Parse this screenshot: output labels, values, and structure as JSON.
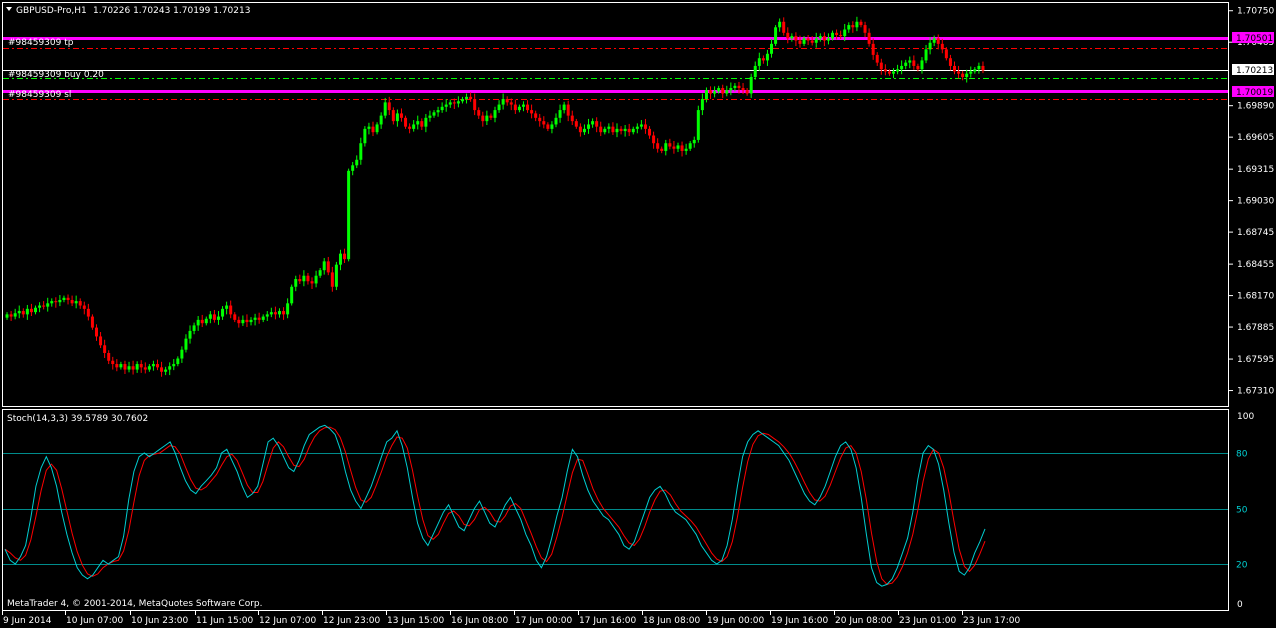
{
  "window": {
    "symbol_title": "GBPUSD-Pro,H1",
    "ohlc_readout": "1.70226 1.70243 1.70199 1.70213"
  },
  "orders": [
    {
      "label": "#98459309 tp",
      "type": "tp",
      "price": 1.70501,
      "price_label": "1.70501",
      "color": "#FF00FF"
    },
    {
      "label": "#98459309 buy 0.20",
      "type": "entry",
      "price": 1.70213,
      "color": "#00FF00"
    },
    {
      "label": "#98459309 sl",
      "type": "sl",
      "price": 1.70019,
      "price_label": "1.70019",
      "color": "#FF00FF"
    }
  ],
  "current_price": {
    "value": 1.70213,
    "label": "1.70213"
  },
  "price_axis": {
    "ticks": [
      "1.70750",
      "1.70465",
      "1.69890",
      "1.69605",
      "1.69315",
      "1.69030",
      "1.68745",
      "1.68455",
      "1.68170",
      "1.67885",
      "1.67595",
      "1.67310"
    ]
  },
  "indicator": {
    "label": "Stoch(14,3,3) 39.5789 30.7602",
    "main_value": 39.5789,
    "signal_value": 30.7602,
    "levels": [
      80,
      50,
      20
    ],
    "level_labels": [
      "80",
      "50",
      "20"
    ],
    "axis_ticks": [
      "100",
      "0"
    ],
    "main_color": "#00CED1",
    "signal_color": "#FF0000"
  },
  "footer": {
    "copyright": "MetaTrader 4, © 2001-2014, MetaQuotes Software Corp."
  },
  "time_axis": {
    "labels": [
      "9 Jun 2014",
      "10 Jun 07:00",
      "10 Jun 23:00",
      "11 Jun 15:00",
      "12 Jun 07:00",
      "12 Jun 23:00",
      "13 Jun 15:00",
      "16 Jun 08:00",
      "17 Jun 00:00",
      "17 Jun 16:00",
      "18 Jun 08:00",
      "19 Jun 00:00",
      "19 Jun 16:00",
      "20 Jun 08:00",
      "23 Jun 01:00",
      "23 Jun 17:00"
    ]
  },
  "colors": {
    "background": "#000000",
    "bull_candle": "#00FF00",
    "bear_candle": "#FF0000",
    "grid_line": "#FFFFFF",
    "order_line": "#FF0000"
  },
  "chart_data": {
    "type": "candlestick",
    "title": "GBPUSD-Pro,H1",
    "series": [
      {
        "name": "GBPUSD",
        "close": [
          1.68,
          1.6798,
          1.6801,
          1.6803,
          1.68,
          1.6805,
          1.6802,
          1.6806,
          1.6808,
          1.6807,
          1.681,
          1.6812,
          1.6811,
          1.6813,
          1.6815,
          1.6813,
          1.681,
          1.6812,
          1.6808,
          1.6805,
          1.6798,
          1.6788,
          1.678,
          1.6772,
          1.6765,
          1.6758,
          1.6755,
          1.6752,
          1.6755,
          1.675,
          1.6753,
          1.675,
          1.6755,
          1.6752,
          1.675,
          1.6753,
          1.6755,
          1.6752,
          1.6748,
          1.675,
          1.6753,
          1.6755,
          1.676,
          1.6768,
          1.6778,
          1.6785,
          1.679,
          1.6795,
          1.6792,
          1.6796,
          1.68,
          1.6795,
          1.6798,
          1.6805,
          1.6808,
          1.68,
          1.6795,
          1.6792,
          1.6795,
          1.6793,
          1.6795,
          1.6797,
          1.6795,
          1.6798,
          1.68,
          1.6802,
          1.68,
          1.6803,
          1.68,
          1.681,
          1.6825,
          1.6832,
          1.683,
          1.6835,
          1.683,
          1.6828,
          1.6835,
          1.684,
          1.6848,
          1.6838,
          1.6825,
          1.6845,
          1.6855,
          1.685,
          1.693,
          1.6935,
          1.694,
          1.6955,
          1.6968,
          1.697,
          1.6965,
          1.6972,
          1.698,
          1.6992,
          1.6985,
          1.6975,
          1.6982,
          1.6978,
          1.697,
          1.6968,
          1.6972,
          1.6975,
          1.697,
          1.6978,
          1.698,
          1.6983,
          1.6985,
          1.6988,
          1.699,
          1.6992,
          1.6991,
          1.6993,
          1.6995,
          1.6997,
          1.6995,
          1.6985,
          1.698,
          1.6975,
          1.698,
          1.6978,
          1.6985,
          1.699,
          1.6995,
          1.6992,
          1.699,
          1.6985,
          1.6988,
          1.699,
          1.6985,
          1.6982,
          1.6978,
          1.6975,
          1.6972,
          1.6968,
          1.6972,
          1.6978,
          1.6985,
          1.699,
          1.698,
          1.6975,
          1.697,
          1.6965,
          1.6968,
          1.6972,
          1.6975,
          1.697,
          1.6965,
          1.6968,
          1.697,
          1.6965,
          1.6968,
          1.6966,
          1.6968,
          1.6965,
          1.6968,
          1.697,
          1.6972,
          1.6968,
          1.6962,
          1.6955,
          1.695,
          1.6948,
          1.6955,
          1.6952,
          1.695,
          1.6953,
          1.6948,
          1.695,
          1.6955,
          1.6958,
          1.6985,
          1.6995,
          1.7003,
          1.7,
          1.7002,
          1.7005,
          1.7,
          1.7003,
          1.7005,
          1.7007,
          1.7005,
          1.7003,
          1.7,
          1.7015,
          1.7025,
          1.7032,
          1.703,
          1.7036,
          1.7045,
          1.706,
          1.7065,
          1.7055,
          1.705,
          1.7052,
          1.7048,
          1.7045,
          1.705,
          1.7048,
          1.7046,
          1.705,
          1.7052,
          1.7048,
          1.705,
          1.7055,
          1.7053,
          1.7052,
          1.7058,
          1.7062,
          1.706,
          1.7065,
          1.7062,
          1.7055,
          1.7045,
          1.7035,
          1.7028,
          1.7022,
          1.702,
          1.7018,
          1.702,
          1.7022,
          1.7025,
          1.7028,
          1.703,
          1.7025,
          1.7022,
          1.703,
          1.704,
          1.7046,
          1.705,
          1.7045,
          1.704,
          1.7032,
          1.7025,
          1.702,
          1.7018,
          1.7015,
          1.7018,
          1.702,
          1.7022,
          1.7025,
          1.7021
        ]
      }
    ],
    "x_labels": [
      "9 Jun 2014",
      "10 Jun 07:00",
      "10 Jun 23:00",
      "11 Jun 15:00",
      "12 Jun 07:00",
      "12 Jun 23:00",
      "13 Jun 15:00",
      "16 Jun 08:00",
      "17 Jun 00:00",
      "17 Jun 16:00",
      "18 Jun 08:00",
      "19 Jun 00:00",
      "19 Jun 16:00",
      "20 Jun 08:00",
      "23 Jun 01:00",
      "23 Jun 17:00"
    ],
    "ylim": [
      1.6717,
      1.7082
    ],
    "grid": false,
    "stochastic": {
      "main": [
        28,
        22,
        20,
        24,
        30,
        45,
        62,
        72,
        78,
        72,
        62,
        48,
        36,
        26,
        18,
        14,
        12,
        14,
        18,
        22,
        20,
        22,
        24,
        35,
        55,
        70,
        78,
        80,
        78,
        80,
        82,
        84,
        86,
        80,
        72,
        65,
        60,
        58,
        62,
        65,
        68,
        72,
        80,
        82,
        76,
        70,
        62,
        56,
        58,
        62,
        74,
        86,
        88,
        84,
        78,
        72,
        70,
        76,
        84,
        90,
        92,
        94,
        95,
        93,
        90,
        82,
        70,
        60,
        54,
        50,
        56,
        62,
        70,
        78,
        86,
        88,
        92,
        84,
        72,
        56,
        42,
        34,
        30,
        36,
        42,
        48,
        52,
        46,
        40,
        38,
        44,
        50,
        54,
        48,
        42,
        40,
        46,
        52,
        56,
        50,
        44,
        36,
        30,
        22,
        18,
        24,
        34,
        46,
        56,
        70,
        82,
        78,
        68,
        60,
        54,
        50,
        46,
        44,
        40,
        36,
        30,
        28,
        32,
        40,
        48,
        56,
        60,
        62,
        58,
        52,
        48,
        46,
        44,
        40,
        36,
        30,
        26,
        22,
        20,
        22,
        30,
        44,
        62,
        78,
        86,
        90,
        92,
        90,
        88,
        86,
        84,
        80,
        76,
        70,
        64,
        58,
        54,
        52,
        56,
        62,
        70,
        78,
        84,
        86,
        82,
        72,
        56,
        36,
        18,
        10,
        8,
        9,
        12,
        18,
        26,
        34,
        48,
        66,
        80,
        84,
        82,
        74,
        60,
        42,
        26,
        16,
        14,
        18,
        26,
        32,
        39
      ]
    }
  }
}
